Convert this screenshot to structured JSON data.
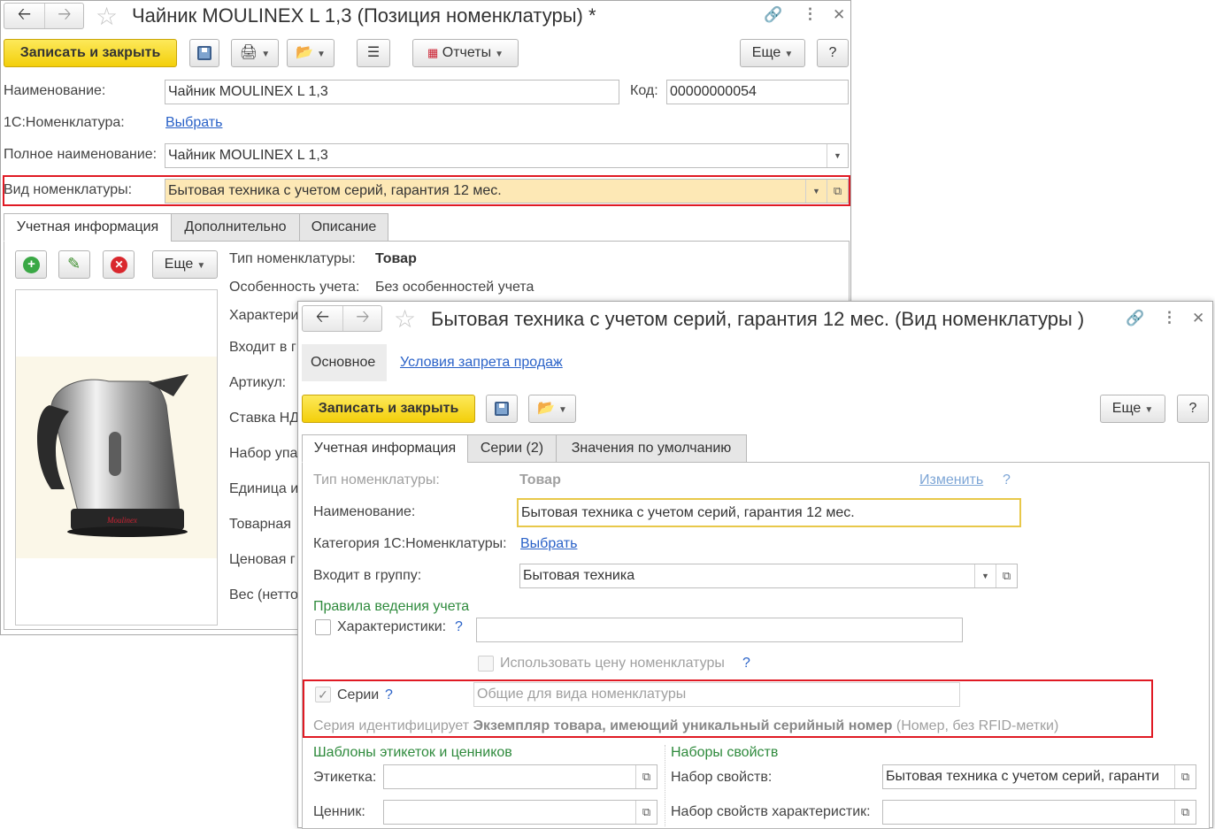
{
  "w1": {
    "title": "Чайник MOULINEX L 1,3 (Позиция номенклатуры) *",
    "btn_save_close": "Записать и закрыть",
    "btn_reports": "Отчеты",
    "btn_more": "Еще",
    "btn_help": "?",
    "lbl_name": "Наименование:",
    "val_name": "Чайник MOULINEX L 1,3",
    "lbl_code": "Код:",
    "val_code": "00000000054",
    "lbl_1c": "1С:Номенклатура:",
    "link_choose": "Выбрать",
    "lbl_fullname": "Полное наименование:",
    "val_fullname": "Чайник MOULINEX L 1,3",
    "lbl_kind": "Вид номенклатуры:",
    "val_kind": "Бытовая техника с учетом серий, гарантия 12 мес.",
    "tabs": [
      "Учетная информация",
      "Дополнительно",
      "Описание"
    ],
    "img_more": "Еще",
    "props": [
      {
        "label": "Тип номенклатуры:",
        "value": "Товар"
      },
      {
        "label": "Особенность учета:",
        "value": "Без особенностей учета"
      },
      {
        "label": "Характери",
        "value": ""
      },
      {
        "label": "Входит в г",
        "value": ""
      },
      {
        "label": "Артикул:",
        "value": ""
      },
      {
        "label": "Ставка НД",
        "value": ""
      },
      {
        "label": "Набор упа",
        "value": ""
      },
      {
        "label": "Единица и",
        "value": ""
      },
      {
        "label": "Товарная",
        "value": ""
      },
      {
        "label": "Ценовая г",
        "value": ""
      },
      {
        "label": "Вес (нетто",
        "value": ""
      }
    ],
    "kettle_brand": "Moulinex"
  },
  "w2": {
    "title": "Бытовая техника с учетом серий, гарантия 12 мес. (Вид номенклатуры )",
    "nav_main": "Основное",
    "nav_link": "Условия запрета продаж",
    "btn_save_close": "Записать и закрыть",
    "btn_more": "Еще",
    "btn_help": "?",
    "tabs": [
      "Учетная информация",
      "Серии (2)",
      "Значения по умолчанию"
    ],
    "lbl_type": "Тип номенклатуры:",
    "val_type": "Товар",
    "link_change": "Изменить",
    "q": "?",
    "lbl_name": "Наименование:",
    "val_name": "Бытовая техника с учетом серий, гарантия 12 мес.",
    "lbl_category": "Категория 1С:Номенклатуры:",
    "link_choose": "Выбрать",
    "lbl_group": "Входит в группу:",
    "val_group": "Бытовая техника",
    "sec_rules": "Правила ведения учета",
    "lbl_chars": "Характеристики:",
    "lbl_use_price": "Использовать цену номенклатуры",
    "lbl_series": "Серии",
    "val_series": "Общие для вида номенклатуры",
    "series_desc_pre": "Серия идентифицирует",
    "series_desc_bold": "Экземпляр товара, имеющий уникальный серийный номер",
    "series_desc_post": "(Номер, без RFID-метки)",
    "sec_templates": "Шаблоны этикеток и ценников",
    "lbl_label": "Этикетка:",
    "lbl_price_tag": "Ценник:",
    "sec_props": "Наборы свойств",
    "lbl_propset": "Набор свойств:",
    "val_propset": "Бытовая техника с учетом серий, гаранти",
    "lbl_propset_chars": "Набор свойств характеристик:"
  },
  "colors": {
    "accent_yellow": "#f5d521",
    "highlight_red": "#e01a24",
    "link_blue": "#2a62c8",
    "section_green": "#2e8a3c"
  }
}
